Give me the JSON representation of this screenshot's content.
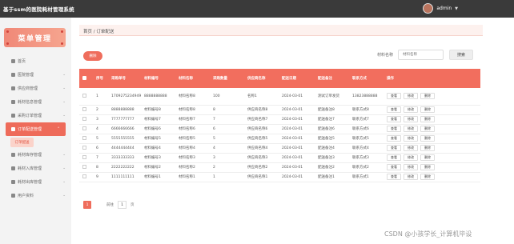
{
  "header": {
    "title": "基于ssm的医院耗材管理系统",
    "user": "admin",
    "caret": "▼"
  },
  "sidebar": {
    "menu_title": "菜单管理",
    "items": [
      {
        "label": "首页",
        "icon": "home-icon",
        "arrow": ""
      },
      {
        "label": "医院管理",
        "icon": "hospital-icon",
        "arrow": "⌄"
      },
      {
        "label": "供应商管理",
        "icon": "supplier-icon",
        "arrow": "⌄"
      },
      {
        "label": "耗材信息管理",
        "icon": "material-icon",
        "arrow": "⌄"
      },
      {
        "label": "采购订单管理",
        "icon": "purchase-icon",
        "arrow": "⌄"
      },
      {
        "label": "订单配送管理",
        "icon": "delivery-icon",
        "arrow": "⌃"
      },
      {
        "label": "耗材库存管理",
        "icon": "stock-icon",
        "arrow": "⌄"
      },
      {
        "label": "耗材入库管理",
        "icon": "inbound-icon",
        "arrow": "⌄"
      },
      {
        "label": "耗材出库管理",
        "icon": "outbound-icon",
        "arrow": "⌄"
      },
      {
        "label": "用户资料",
        "icon": "user-icon",
        "arrow": "⌄"
      }
    ],
    "sub_item": "订单配送"
  },
  "breadcrumb": "首页 / 订单配送",
  "toolbar": {
    "delete_label": "删除",
    "search_label": "材料名称",
    "search_placeholder": "材料名称",
    "search_button": "搜索"
  },
  "table": {
    "headers": [
      "",
      "序号",
      "采购单号",
      "材料编号",
      "材料名称",
      "采购数量",
      "供应商名称",
      "配送日期",
      "配送备注",
      "联系方式",
      "操作"
    ],
    "rows": [
      {
        "no": "1",
        "order": "1709275234949",
        "code": "8888888888",
        "name": "材料名称8",
        "qty": "100",
        "supplier": "名称1",
        "date": "2024-03-01",
        "remark": "测试订单发货",
        "contact": "13823888888"
      },
      {
        "no": "2",
        "order": "8888888888",
        "code": "材料编号8",
        "name": "材料名称8",
        "qty": "8",
        "supplier": "供应商名称8",
        "date": "2024-03-01",
        "remark": "配送备注8",
        "contact": "联系方式8"
      },
      {
        "no": "3",
        "order": "7777777777",
        "code": "材料编号7",
        "name": "材料名称7",
        "qty": "7",
        "supplier": "供应商名称7",
        "date": "2024-03-01",
        "remark": "配送备注7",
        "contact": "联系方式7"
      },
      {
        "no": "4",
        "order": "6666666666",
        "code": "材料编号6",
        "name": "材料名称6",
        "qty": "6",
        "supplier": "供应商名称6",
        "date": "2024-03-01",
        "remark": "配送备注6",
        "contact": "联系方式6"
      },
      {
        "no": "5",
        "order": "5555555555",
        "code": "材料编号5",
        "name": "材料名称5",
        "qty": "5",
        "supplier": "供应商名称5",
        "date": "2024-03-01",
        "remark": "配送备注5",
        "contact": "联系方式5"
      },
      {
        "no": "6",
        "order": "4444444444",
        "code": "材料编号4",
        "name": "材料名称4",
        "qty": "4",
        "supplier": "供应商名称4",
        "date": "2024-03-01",
        "remark": "配送备注4",
        "contact": "联系方式4"
      },
      {
        "no": "7",
        "order": "3333333333",
        "code": "材料编号3",
        "name": "材料名称3",
        "qty": "3",
        "supplier": "供应商名称3",
        "date": "2024-03-01",
        "remark": "配送备注3",
        "contact": "联系方式3"
      },
      {
        "no": "8",
        "order": "2222222222",
        "code": "材料编号2",
        "name": "材料名称2",
        "qty": "2",
        "supplier": "供应商名称2",
        "date": "2024-03-01",
        "remark": "配送备注2",
        "contact": "联系方式2"
      },
      {
        "no": "9",
        "order": "1111111111",
        "code": "材料编号1",
        "name": "材料名称1",
        "qty": "1",
        "supplier": "供应商名称1",
        "date": "2024-03-01",
        "remark": "配送备注1",
        "contact": "联系方式1"
      }
    ],
    "ops": [
      "查看",
      "修改",
      "删除"
    ]
  },
  "pager": {
    "current": "1",
    "goto_label": "前往",
    "page_value": "1",
    "page_suffix": "页"
  },
  "watermark": "CSDN @小孩学长_计算机毕设",
  "colors": {
    "accent": "#ef6d5c",
    "topbar": "#3a3a3a"
  }
}
